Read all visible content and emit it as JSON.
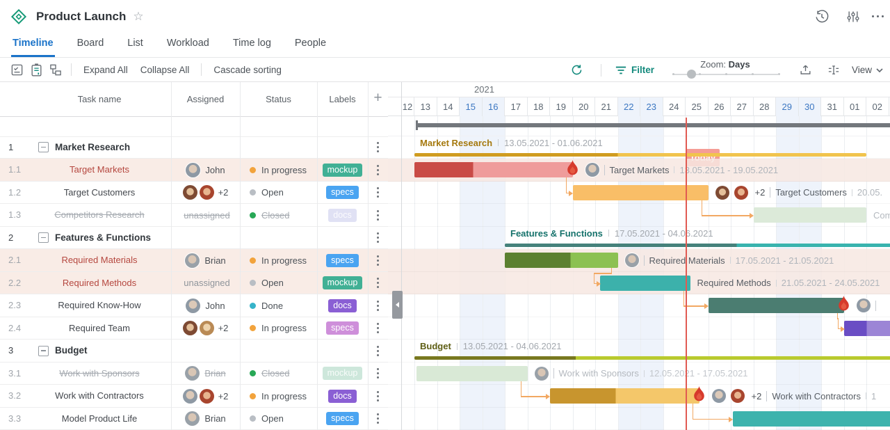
{
  "header": {
    "title": "Product Launch"
  },
  "tabs": [
    {
      "label": "Timeline",
      "active": true
    },
    {
      "label": "Board"
    },
    {
      "label": "List"
    },
    {
      "label": "Workload"
    },
    {
      "label": "Time log"
    },
    {
      "label": "People"
    }
  ],
  "toolbar": {
    "expand_all": "Expand All",
    "collapse_all": "Collapse All",
    "cascade": "Cascade sorting",
    "filter": "Filter",
    "zoom_label": "Zoom:",
    "zoom_value": "Days",
    "view_label": "View",
    "zoom_handle_pos": 0.18
  },
  "timeline": {
    "year": "2021",
    "days": [
      "12",
      "13",
      "14",
      "15",
      "16",
      "17",
      "18",
      "19",
      "20",
      "21",
      "22",
      "23",
      "24",
      "25",
      "26",
      "27",
      "28",
      "29",
      "30",
      "31",
      "01",
      "02"
    ],
    "weekend_days": [
      "15",
      "16",
      "22",
      "23",
      "29",
      "30"
    ],
    "today_label": "Today",
    "today_day": "25"
  },
  "colors": {
    "accent_blue": "#1a73c9",
    "teal_accent": "#12897c",
    "today_line": "#e15a52",
    "today_badge": "#f59d96",
    "project_bar": "#73777c",
    "link": "#f2a862",
    "status": {
      "progress": "#f2a33c",
      "open": "#b9bec4",
      "closed": "#27a856",
      "done": "#36b3c9"
    },
    "labels": {
      "teal": "#41b095",
      "blue": "#4aa4f1",
      "purple": "#8a5fd4",
      "lavender": "#ce8fda",
      "docs_faded": "#e0e1f4",
      "mockup_faded": "#cde7db"
    }
  },
  "table": {
    "columns": [
      "Task name",
      "Assigned",
      "Status",
      "Labels"
    ],
    "rows": [
      {
        "num": "1",
        "group": true,
        "name": "Market Research"
      },
      {
        "num": "1.1",
        "name": "Target Markets",
        "name_red": true,
        "bg": true,
        "avatars": [
          "john"
        ],
        "aname": "John",
        "status": "In progress",
        "st": "progress",
        "label": "mockup",
        "lcolor": "teal"
      },
      {
        "num": "1.2",
        "name": "Target Customers",
        "avatars": [
          "amy",
          "rob"
        ],
        "plus": "+2",
        "status": "Open",
        "st": "open",
        "label": "specs",
        "lcolor": "blue"
      },
      {
        "num": "1.3",
        "name": "Competitors Research",
        "strike": true,
        "aname": "unassigned",
        "status": "Closed",
        "st": "closed",
        "label": "docs",
        "lcolor": "docs_faded"
      },
      {
        "num": "2",
        "group": true,
        "name": "Features & Functions"
      },
      {
        "num": "2.1",
        "name": "Required Materials",
        "name_red": true,
        "bg": true,
        "avatars": [
          "brian"
        ],
        "aname": "Brian",
        "status": "In progress",
        "st": "progress",
        "label": "specs",
        "lcolor": "blue"
      },
      {
        "num": "2.2",
        "name": "Required Methods",
        "name_red": true,
        "bg": true,
        "aname": "unassigned",
        "status": "Open",
        "st": "open",
        "label": "mockup",
        "lcolor": "teal"
      },
      {
        "num": "2.3",
        "name": "Required Know-How",
        "avatars": [
          "john"
        ],
        "aname": "John",
        "status": "Done",
        "st": "done",
        "label": "docs",
        "lcolor": "purple"
      },
      {
        "num": "2.4",
        "name": "Required Team",
        "avatars": [
          "amy",
          "kate"
        ],
        "plus": "+2",
        "status": "In progress",
        "st": "progress",
        "label": "specs",
        "lcolor": "lavender"
      },
      {
        "num": "3",
        "group": true,
        "name": "Budget"
      },
      {
        "num": "3.1",
        "name": "Work with Sponsors",
        "strike": true,
        "avatars": [
          "brian"
        ],
        "aname": "Brian",
        "status": "Closed",
        "st": "closed",
        "label": "mockup",
        "lcolor": "mockup_faded"
      },
      {
        "num": "3.2",
        "name": "Work with Contractors",
        "avatars": [
          "john",
          "rob"
        ],
        "plus": "+2",
        "status": "In progress",
        "st": "progress",
        "label": "docs",
        "lcolor": "purple"
      },
      {
        "num": "3.3",
        "name": "Model Product Life",
        "avatars": [
          "brian"
        ],
        "aname": "Brian",
        "status": "Open",
        "st": "open",
        "label": "specs",
        "lcolor": "blue"
      }
    ]
  },
  "gantt": {
    "rows": [
      {
        "kind": "summary",
        "name": "Market Research",
        "dates": "13.05.2021 - 01.06.2021",
        "s": 13,
        "e": 33,
        "prog": 0.45,
        "dark": "#d09c20",
        "light": "#f1c44d",
        "lab": "#a5790e"
      },
      {
        "kind": "task",
        "bg": true,
        "s": 13,
        "e": 20,
        "prog": 0.37,
        "dark": "#c94b46",
        "light": "#ef9c9b",
        "flame": true,
        "avatars": [
          "john"
        ],
        "name": "Target Markets",
        "dates": "13.05.2021 - 19.05.2021",
        "link": "straight"
      },
      {
        "kind": "task",
        "s": 20,
        "e": 26,
        "light": "#f9be67",
        "avatars": [
          "amy",
          "rob"
        ],
        "plus": "+2",
        "name": "Target Customers",
        "dates": "20.05.",
        "link": "straight"
      },
      {
        "kind": "task",
        "s": 28,
        "e": 33,
        "light": "#dcead9",
        "muted": true,
        "name": "Competitors Research"
      },
      {
        "kind": "summary",
        "name": "Features & Functions",
        "dates": "17.05.2021 - 04.06.2021",
        "s": 17,
        "e": 36,
        "prog": 0.54,
        "dark": "#45817b",
        "light": "#38b3ae",
        "lab": "#15726b"
      },
      {
        "kind": "task",
        "bg": true,
        "s": 17,
        "e": 22,
        "prog": 0.58,
        "dark": "#5c8030",
        "light": "#8cc152",
        "avatars": [
          "brian"
        ],
        "name": "Required Materials",
        "dates": "17.05.2021 - 21.05.2021",
        "link": "zig"
      },
      {
        "kind": "task",
        "bg": true,
        "s": 21.2,
        "e": 25.2,
        "light": "#3cb1ab",
        "name": "Required Methods",
        "dates": "21.05.2021 - 24.05.2021",
        "link": "straight"
      },
      {
        "kind": "task",
        "s": 26,
        "e": 32,
        "light": "#4b7d71",
        "flame": true,
        "avatars": [
          "john"
        ],
        "sep_only": true,
        "link": "zig"
      },
      {
        "kind": "task",
        "s": 32,
        "e": 36,
        "prog": 0.25,
        "dark": "#6a4dc4",
        "light": "#9c85d6"
      },
      {
        "kind": "summary",
        "name": "Budget",
        "dates": "13.05.2021 - 04.06.2021",
        "s": 13,
        "e": 36,
        "prog": 0.31,
        "dark": "#78781f",
        "light": "#b9ca2e",
        "lab": "#5e5e14"
      },
      {
        "kind": "task",
        "s": 13.1,
        "e": 18,
        "light": "#d9e9d6",
        "muted": true,
        "avatars": [
          "brian"
        ],
        "name": "Work with Sponsors",
        "dates": "12.05.2021 - 17.05.2021",
        "link": "straight"
      },
      {
        "kind": "task",
        "s": 19,
        "e": 25.6,
        "prog": 0.44,
        "dark": "#c8952e",
        "light": "#f4c76a",
        "flame": true,
        "avatars": [
          "john",
          "rob"
        ],
        "plus": "+2",
        "name": "Work with Contractors",
        "dates": "1",
        "link": "straight"
      },
      {
        "kind": "task",
        "s": 27.1,
        "e": 36,
        "light": "#3db3ad"
      }
    ]
  }
}
